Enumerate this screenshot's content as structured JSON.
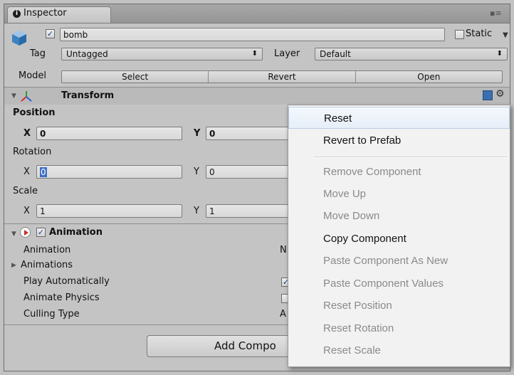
{
  "window": {
    "tab_title": "Inspector",
    "info_glyph": "i",
    "menu_glyph": "▪≡"
  },
  "object": {
    "name": "bomb",
    "active": true,
    "static_label": "Static",
    "static_checked": false
  },
  "tag": {
    "label": "Tag",
    "value": "Untagged"
  },
  "layer": {
    "label": "Layer",
    "value": "Default"
  },
  "model": {
    "label": "Model",
    "buttons": [
      "Select",
      "Revert",
      "Open"
    ]
  },
  "transform": {
    "title": "Transform",
    "position": {
      "label": "Position",
      "x_label": "X",
      "x": "0",
      "y_label": "Y",
      "y": "0"
    },
    "rotation": {
      "label": "Rotation",
      "x_label": "X",
      "x": "0",
      "y_label": "Y",
      "y": "0"
    },
    "scale": {
      "label": "Scale",
      "x_label": "X",
      "x": "1",
      "y_label": "Y",
      "y": "1"
    }
  },
  "animation": {
    "title": "Animation",
    "enabled": true,
    "rows": [
      {
        "label": "Animation",
        "value": "N"
      },
      {
        "label": "Animations",
        "value": ""
      },
      {
        "label": "Play Automatically",
        "value": ""
      },
      {
        "label": "Animate Physics",
        "value": ""
      },
      {
        "label": "Culling Type",
        "value": "A"
      }
    ]
  },
  "add_component": {
    "label": "Add Compo"
  },
  "context_menu": {
    "items": [
      {
        "label": "Reset",
        "enabled": true
      },
      {
        "label": "Revert to Prefab",
        "enabled": true
      },
      {
        "label": "Remove Component",
        "enabled": false
      },
      {
        "label": "Move Up",
        "enabled": false
      },
      {
        "label": "Move Down",
        "enabled": false
      },
      {
        "label": "Copy Component",
        "enabled": true
      },
      {
        "label": "Paste Component As New",
        "enabled": false
      },
      {
        "label": "Paste Component Values",
        "enabled": false
      },
      {
        "label": "Reset Position",
        "enabled": false
      },
      {
        "label": "Reset Rotation",
        "enabled": false
      },
      {
        "label": "Reset Scale",
        "enabled": false
      }
    ]
  }
}
